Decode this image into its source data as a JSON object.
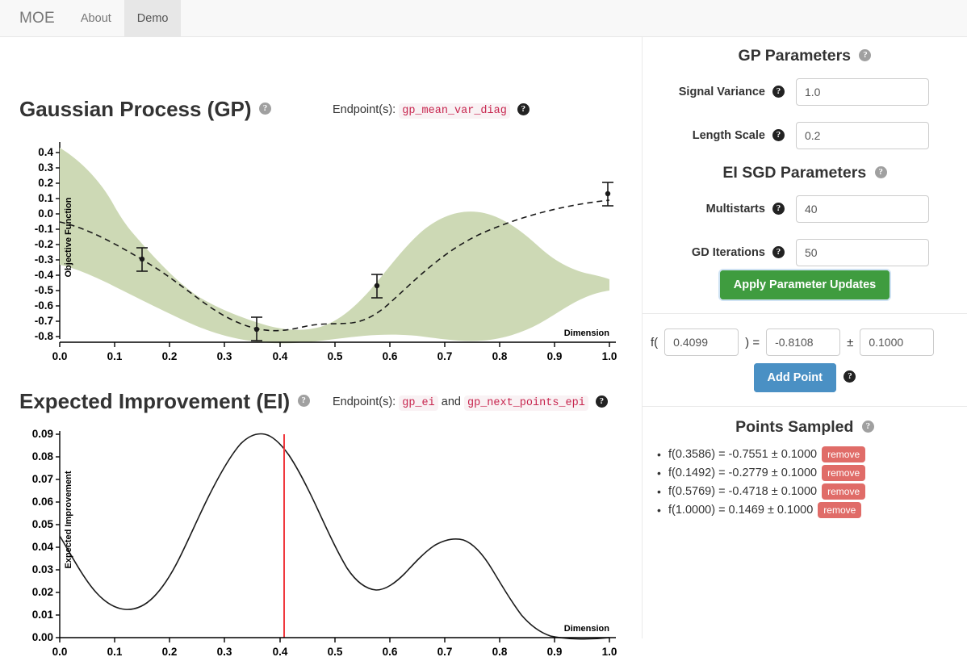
{
  "nav": {
    "brand": "MOE",
    "tabs": [
      {
        "label": "About",
        "active": false
      },
      {
        "label": "Demo",
        "active": true
      }
    ]
  },
  "gp_section": {
    "title": "Gaussian Process (GP)",
    "help": "?",
    "endpoints_label": "Endpoint(s):",
    "endpoints": [
      "gp_mean_var_diag"
    ]
  },
  "ei_section": {
    "title": "Expected Improvement (EI)",
    "help": "?",
    "endpoints_label": "Endpoint(s):",
    "endpoints": [
      "gp_ei",
      "gp_next_points_epi"
    ],
    "conjunction": "and"
  },
  "params": {
    "gp_title": "GP Parameters",
    "ei_title": "EI SGD Parameters",
    "fields": [
      {
        "label": "Signal Variance",
        "value": "1.0"
      },
      {
        "label": "Length Scale",
        "value": "0.2"
      },
      {
        "label": "Multistarts",
        "value": "40"
      },
      {
        "label": "GD Iterations",
        "value": "50"
      }
    ],
    "apply_button": "Apply Parameter Updates"
  },
  "add_point": {
    "f_open": "f(",
    "x_value": "0.4099",
    "close_eq": ") =",
    "y_value": "-0.8108",
    "pm": "±",
    "err_value": "0.1000",
    "button": "Add Point"
  },
  "points_sampled": {
    "title": "Points Sampled",
    "remove_label": "remove",
    "items": [
      {
        "text": "f(0.3586) = -0.7551 ± 0.1000"
      },
      {
        "text": "f(0.1492) = -0.2779 ± 0.1000"
      },
      {
        "text": "f(0.5769) = -0.4718 ± 0.1000"
      },
      {
        "text": "f(1.0000) = 0.1469 ± 0.1000"
      }
    ]
  },
  "colors": {
    "band_green": "#cdd9b5",
    "accent_green": "#3f9c3f",
    "accent_blue": "#4a90c4",
    "remove_red": "#e06c68",
    "code_pink": "#c7254e",
    "ei_marker_red": "#f0383e"
  },
  "chart_data": [
    {
      "type": "line",
      "title": "Gaussian Process (GP)",
      "xlabel": "Dimension",
      "ylabel": "Objective Function",
      "xlim": [
        0.0,
        1.0
      ],
      "ylim": [
        -0.8,
        0.45
      ],
      "xticks": [
        "0.0",
        "0.1",
        "0.2",
        "0.3",
        "0.4",
        "0.5",
        "0.6",
        "0.7",
        "0.8",
        "0.9",
        "1.0"
      ],
      "yticks": [
        "0.4",
        "0.3",
        "0.2",
        "0.1",
        "0.0",
        "-0.1",
        "-0.2",
        "-0.3",
        "-0.4",
        "-0.5",
        "-0.6",
        "-0.7",
        "-0.8"
      ],
      "grid": false,
      "legend": "none",
      "series": [
        {
          "name": "GP mean",
          "style": "dashed",
          "x": [
            0.0,
            0.05,
            0.1,
            0.1492,
            0.2,
            0.25,
            0.3,
            0.3586,
            0.4,
            0.45,
            0.5,
            0.5769,
            0.65,
            0.7,
            0.75,
            0.8,
            0.85,
            0.9,
            0.95,
            1.0
          ],
          "y": [
            -0.05,
            -0.09,
            -0.15,
            -0.278,
            -0.35,
            -0.43,
            -0.53,
            -0.755,
            -0.715,
            -0.705,
            -0.7,
            -0.472,
            -0.33,
            -0.24,
            -0.15,
            -0.06,
            0.01,
            0.06,
            0.105,
            0.147
          ]
        },
        {
          "name": "confidence band (±1 std)",
          "style": "area",
          "x": [
            0.0,
            0.05,
            0.1,
            0.1492,
            0.2,
            0.25,
            0.3,
            0.3586,
            0.4,
            0.45,
            0.5,
            0.5769,
            0.65,
            0.7,
            0.75,
            0.8,
            0.85,
            0.9,
            0.95,
            1.0
          ],
          "upper": [
            0.43,
            0.3,
            0.17,
            -0.225,
            -0.275,
            -0.35,
            -0.45,
            -0.7,
            -0.65,
            -0.615,
            -0.58,
            -0.42,
            -0.16,
            -0.01,
            0.15,
            0.25,
            0.29,
            0.28,
            0.23,
            0.185
          ],
          "lower": [
            -0.47,
            -0.43,
            -0.4,
            -0.33,
            -0.425,
            -0.5,
            -0.6,
            -0.805,
            -0.78,
            -0.79,
            -0.8,
            -0.525,
            -0.5,
            -0.51,
            -0.5,
            -0.455,
            -0.37,
            -0.26,
            -0.15,
            0.1
          ]
        }
      ],
      "points": [
        {
          "x": 0.3586,
          "y": -0.7551,
          "err": 0.1
        },
        {
          "x": 0.1492,
          "y": -0.2779,
          "err": 0.1
        },
        {
          "x": 0.5769,
          "y": -0.4718,
          "err": 0.1
        },
        {
          "x": 1.0,
          "y": 0.1469,
          "err": 0.1
        }
      ]
    },
    {
      "type": "line",
      "title": "Expected Improvement (EI)",
      "xlabel": "Dimension",
      "ylabel": "Expected Improvement",
      "xlim": [
        0.0,
        1.0
      ],
      "ylim": [
        0.0,
        0.092
      ],
      "xticks": [
        "0.0",
        "0.1",
        "0.2",
        "0.3",
        "0.4",
        "0.5",
        "0.6",
        "0.7",
        "0.8",
        "0.9",
        "1.0"
      ],
      "yticks": [
        "0.09",
        "0.08",
        "0.07",
        "0.06",
        "0.05",
        "0.04",
        "0.03",
        "0.02",
        "0.01",
        "0.00"
      ],
      "grid": false,
      "legend": "none",
      "series": [
        {
          "name": "Expected Improvement",
          "style": "solid",
          "x": [
            0.0,
            0.05,
            0.1,
            0.14,
            0.18,
            0.22,
            0.26,
            0.3,
            0.34,
            0.38,
            0.4099,
            0.45,
            0.5,
            0.55,
            0.585,
            0.62,
            0.66,
            0.7,
            0.755,
            0.8,
            0.85,
            0.9,
            0.95,
            1.0
          ],
          "y": [
            0.045,
            0.029,
            0.015,
            0.0072,
            0.0078,
            0.0125,
            0.023,
            0.039,
            0.062,
            0.084,
            0.09,
            0.0845,
            0.061,
            0.032,
            0.0222,
            0.0255,
            0.035,
            0.043,
            0.0465,
            0.042,
            0.028,
            0.0135,
            0.0045,
            0.0
          ]
        }
      ],
      "markers": [
        {
          "name": "next-point-line",
          "x": 0.4099,
          "color": "#f0383e"
        }
      ]
    }
  ]
}
